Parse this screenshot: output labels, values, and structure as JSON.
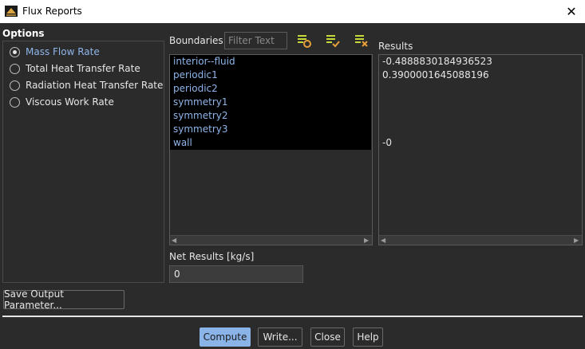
{
  "window": {
    "title": "Flux Reports",
    "close_glyph": "✕",
    "icon": "flux-reports-app-icon"
  },
  "options": {
    "label": "Options",
    "items": [
      {
        "label": "Mass Flow Rate",
        "selected": true
      },
      {
        "label": "Total Heat Transfer Rate",
        "selected": false
      },
      {
        "label": "Radiation Heat Transfer Rate",
        "selected": false
      },
      {
        "label": "Viscous Work Rate",
        "selected": false
      }
    ]
  },
  "boundaries": {
    "label": "Boundaries",
    "filter_placeholder": "Filter Text",
    "toolbar_icons": [
      "select-all-icon",
      "deselect-icon",
      "clear-selection-icon"
    ],
    "items": [
      "interior--fluid",
      "periodic1",
      "periodic2",
      "symmetry1",
      "symmetry2",
      "symmetry3",
      "wall"
    ]
  },
  "results": {
    "label": "Results",
    "items": [
      "-0.4888830184936523",
      "0.3900001645088196",
      "",
      "",
      "",
      "",
      "-0"
    ]
  },
  "net_results": {
    "label": "Net Results [kg/s]",
    "value": "0"
  },
  "buttons": {
    "save_output": "Save Output Parameter...",
    "compute": "Compute",
    "write": "Write...",
    "close": "Close",
    "help": "Help"
  },
  "colors": {
    "accent": "#8ab4e8",
    "background": "#2b2b2b",
    "selected_text": "#8fb5ea",
    "list_highlight": "#000000"
  }
}
